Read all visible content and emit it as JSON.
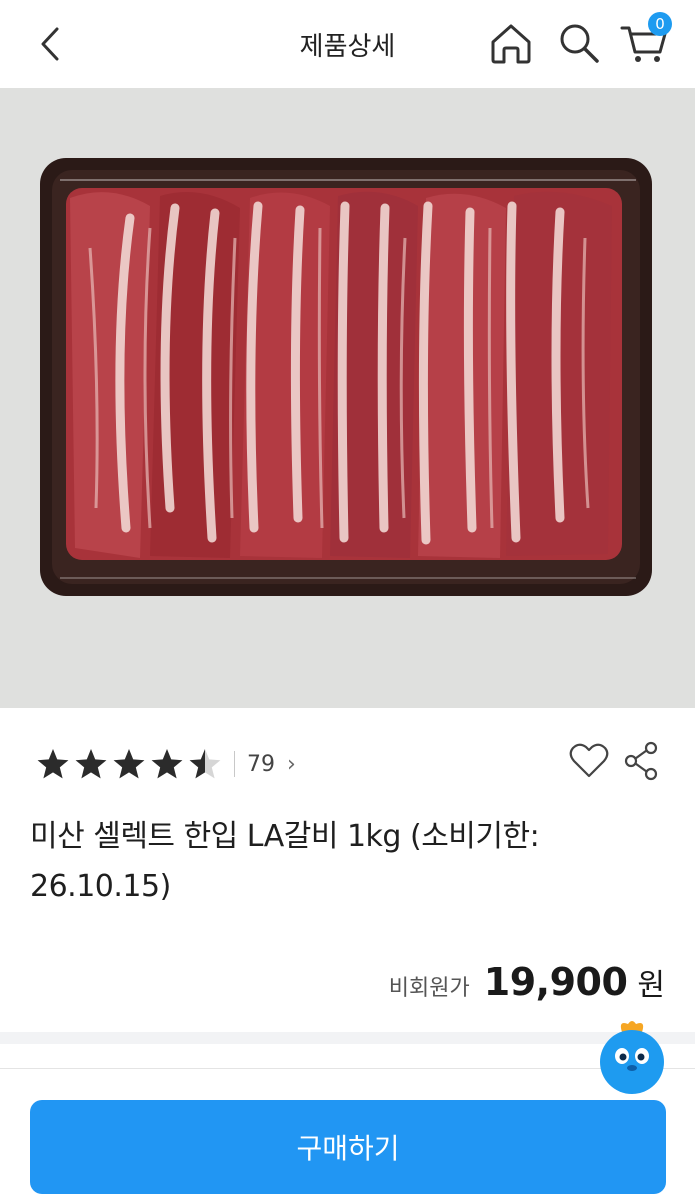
{
  "header": {
    "title": "제품상세",
    "back_icon": "chevron-left-icon",
    "home_icon": "home-icon",
    "search_icon": "search-icon",
    "cart_icon": "cart-icon",
    "cart_count": "0"
  },
  "product": {
    "image_icon": "product-photo-beef-ribs",
    "rating": 4.5,
    "rating_max": 5,
    "review_count": "79",
    "review_chevron": "›",
    "title": "미산 셀렉트 한입 LA갈비 1kg (소비기한: 26.10.15)",
    "price_label": "비회원가",
    "price": "19,900",
    "price_unit": "원"
  },
  "actions": {
    "like_icon": "heart-icon",
    "share_icon": "share-icon",
    "buy_label": "구매하기"
  },
  "colors": {
    "accent": "#2196f3",
    "badge": "#1e9bf0",
    "star": "#2b2b2b"
  }
}
